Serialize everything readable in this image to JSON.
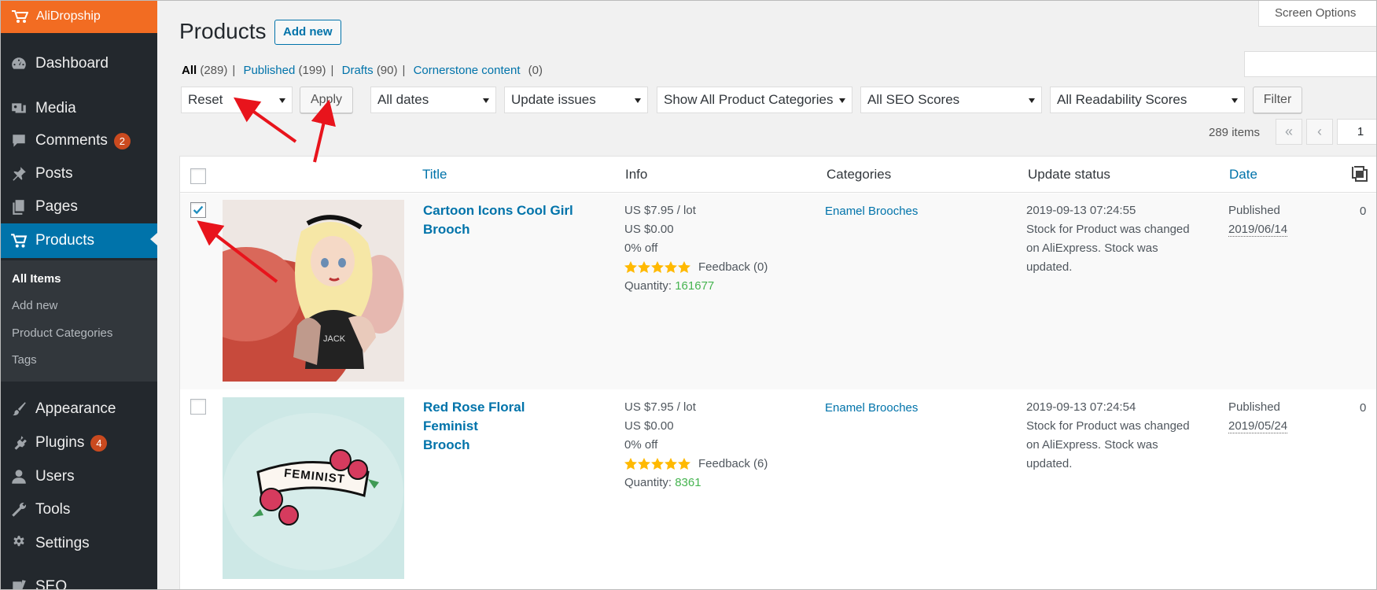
{
  "sidebar": {
    "brand": "AliDropship",
    "items": [
      {
        "label": "Dashboard",
        "icon": "dashboard-icon"
      },
      {
        "label": "Media",
        "icon": "media-icon"
      },
      {
        "label": "Comments",
        "icon": "comments-icon",
        "badge": "2"
      },
      {
        "label": "Posts",
        "icon": "pin-icon"
      },
      {
        "label": "Pages",
        "icon": "pages-icon"
      },
      {
        "label": "Products",
        "icon": "cart-icon"
      },
      {
        "label": "Appearance",
        "icon": "paintbrush-icon"
      },
      {
        "label": "Plugins",
        "icon": "plugin-icon",
        "badge": "4"
      },
      {
        "label": "Users",
        "icon": "user-icon"
      },
      {
        "label": "Tools",
        "icon": "wrench-icon"
      },
      {
        "label": "Settings",
        "icon": "settings-icon"
      },
      {
        "label": "SEO",
        "icon": "seo-icon"
      }
    ],
    "submenu": [
      "All Items",
      "Add new",
      "Product Categories",
      "Tags"
    ]
  },
  "header": {
    "title": "Products",
    "add_new": "Add new",
    "screen_options": "Screen Options"
  },
  "views": {
    "all": "All",
    "all_count": "(289)",
    "published": "Published",
    "published_count": "(199)",
    "drafts": "Drafts",
    "drafts_count": "(90)",
    "cornerstone": "Cornerstone content",
    "cornerstone_count": "(0)"
  },
  "filters": {
    "bulk_action": "Reset",
    "apply": "Apply",
    "dates": "All dates",
    "update": "Update issues",
    "categories": "Show All Product Categories",
    "seo": "All SEO Scores",
    "readability": "All Readability Scores",
    "filter": "Filter"
  },
  "pagination": {
    "items": "289 items",
    "first": "«",
    "prev": "‹",
    "current_page": "1"
  },
  "table": {
    "columns": [
      "Title",
      "Info",
      "Categories",
      "Update status",
      "Date"
    ],
    "rows": [
      {
        "title_line1": "Cartoon Icons Cool Girl",
        "title_line2": "Brooch",
        "price": "US $7.95 / lot",
        "sale": "US $0.00",
        "discount": "0% off",
        "feedback": "Feedback (0)",
        "quantity_label": "Quantity:",
        "quantity": "161677",
        "category": "Enamel Brooches",
        "update_time": "2019-09-13 07:24:55",
        "update_l1": "Stock for Product was changed",
        "update_l2": "on AliExpress. Stock was",
        "update_l3": "updated.",
        "status": "Published",
        "date": "2019/06/14",
        "comments": "0",
        "checked": true
      },
      {
        "title_line1": "Red Rose Floral Feminist",
        "title_line2": "Brooch",
        "price": "US $7.95 / lot",
        "sale": "US $0.00",
        "discount": "0% off",
        "feedback": "Feedback (6)",
        "quantity_label": "Quantity:",
        "quantity": "8361",
        "category": "Enamel Brooches",
        "update_time": "2019-09-13 07:24:54",
        "update_l1": "Stock for Product was changed",
        "update_l2": "on AliExpress. Stock was",
        "update_l3": "updated.",
        "status": "Published",
        "date": "2019/05/24",
        "comments": "0",
        "checked": false,
        "banner": "FEMINIST"
      }
    ]
  },
  "colors": {
    "brand": "#f26c22",
    "sidebar": "#23282d",
    "active": "#0073aa",
    "link": "#0073aa",
    "annotation_arrow": "#e8141c",
    "star": "#ffb900"
  }
}
